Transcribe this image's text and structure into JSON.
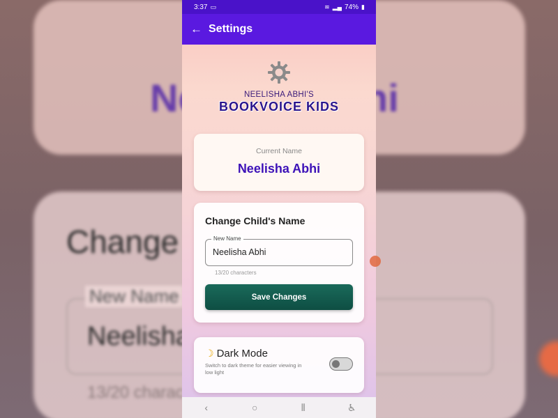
{
  "status_bar": {
    "time": "3:37",
    "battery": "74%"
  },
  "app_bar": {
    "title": "Settings"
  },
  "header": {
    "subtitle": "NEELISHA ABHI'S",
    "brand": "BOOKVOICE KIDS"
  },
  "current_name": {
    "label": "Current Name",
    "value": "Neelisha Abhi"
  },
  "change_name": {
    "title": "Change Child's Name",
    "field_label": "New Name",
    "field_value": "Neelisha Abhi",
    "counter": "13/20 characters",
    "save_label": "Save Changes"
  },
  "dark_mode": {
    "title": "Dark Mode",
    "description": "Switch to dark theme for easier viewing in low light",
    "enabled": false
  },
  "background": {
    "title_left": "Ne",
    "title_right": "hi",
    "change": "Change",
    "new_name": "New Name",
    "value": "Neelisha",
    "counter": "13/20 charac"
  },
  "colors": {
    "accent": "#5a19e0",
    "button": "#0e4e43",
    "brand": "#2a148c"
  }
}
